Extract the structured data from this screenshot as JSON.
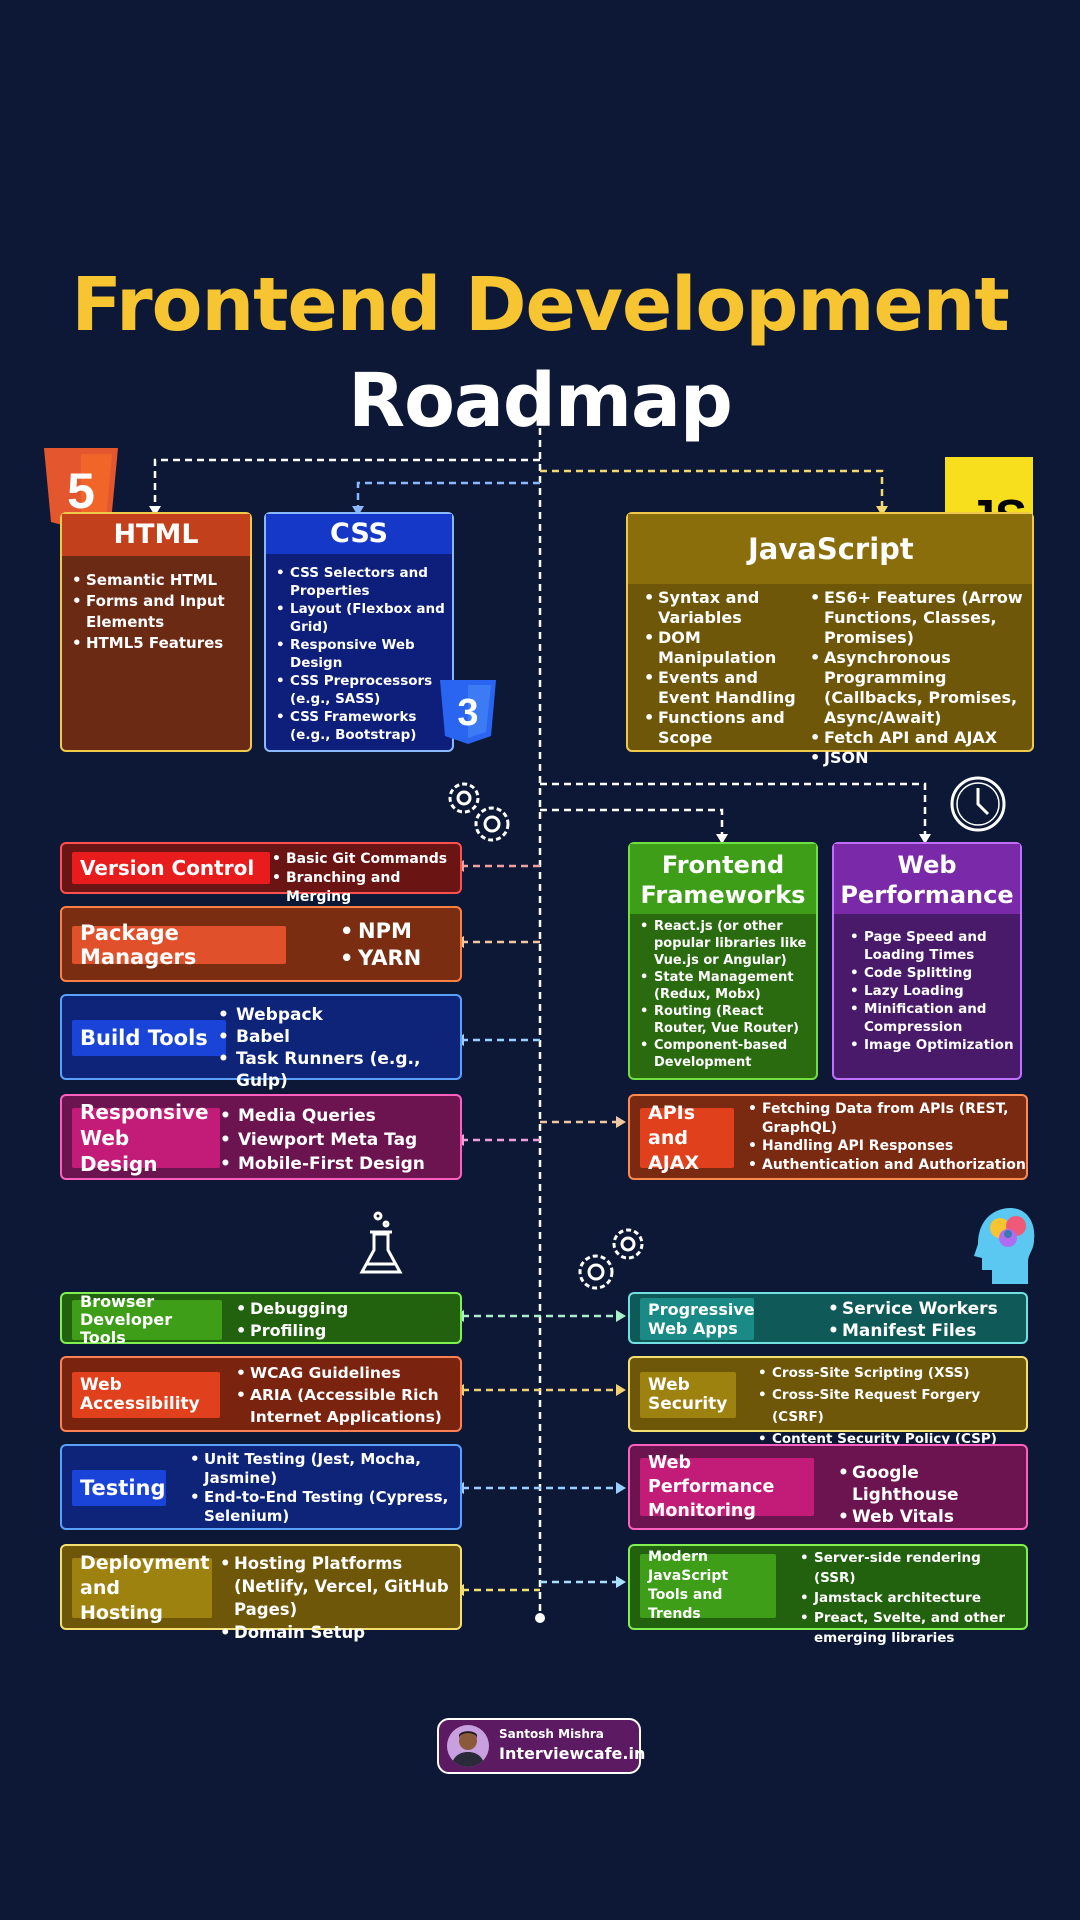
{
  "title": {
    "line1": "Frontend Development",
    "line2": "Roadmap"
  },
  "logos": {
    "html5": "5",
    "css3": "3",
    "js": "JS"
  },
  "html": {
    "title": "HTML",
    "items": [
      "Semantic HTML",
      "Forms and Input Elements",
      "HTML5 Features"
    ]
  },
  "css": {
    "title": "CSS",
    "items": [
      "CSS Selectors and Properties",
      "Layout (Flexbox and Grid)",
      "Responsive Web Design",
      "CSS Preprocessors (e.g., SASS)",
      "CSS Frameworks (e.g., Bootstrap)"
    ]
  },
  "javascript": {
    "title": "JavaScript",
    "col1": [
      "Syntax and Variables",
      "DOM Manipulation",
      "Events and Event Handling",
      "Functions and Scope"
    ],
    "col2": [
      "ES6+ Features (Arrow Functions, Classes, Promises)",
      "Asynchronous Programming (Callbacks, Promises, Async/Await)",
      "Fetch API and AJAX",
      "JSON"
    ]
  },
  "version_control": {
    "label": "Version Control",
    "items": [
      "Basic Git Commands",
      "Branching and Merging"
    ]
  },
  "package_managers": {
    "label": "Package Managers",
    "items": [
      "NPM",
      "YARN"
    ]
  },
  "build_tools": {
    "label": "Build Tools",
    "items": [
      "Webpack",
      "Babel",
      "Task Runners (e.g., Gulp)"
    ]
  },
  "responsive": {
    "label": "Responsive Web Design",
    "items": [
      "Media Queries",
      "Viewport Meta Tag",
      "Mobile-First Design"
    ]
  },
  "frameworks": {
    "title": "Frontend Frameworks",
    "items": [
      "React.js (or other popular libraries like Vue.js or Angular)",
      "State Management (Redux, Mobx)",
      "Routing (React Router, Vue Router)",
      "Component-based Development"
    ]
  },
  "web_performance": {
    "title": "Web Performance",
    "items": [
      "Page Speed and Loading Times",
      "Code Splitting",
      "Lazy Loading",
      "Minification and Compression",
      "Image Optimization"
    ]
  },
  "apis": {
    "label": "APIs and AJAX",
    "items": [
      "Fetching Data from APIs (REST, GraphQL)",
      "Handling API Responses",
      "Authentication and Authorization"
    ]
  },
  "devtools": {
    "label": "Browser Developer Tools",
    "items": [
      "Debugging",
      "Profiling"
    ]
  },
  "accessibility": {
    "label": "Web Accessibility",
    "items": [
      "WCAG Guidelines",
      "ARIA (Accessible Rich Internet Applications)"
    ]
  },
  "testing": {
    "label": "Testing",
    "items": [
      "Unit Testing (Jest, Mocha, Jasmine)",
      "End-to-End Testing (Cypress, Selenium)"
    ]
  },
  "deployment": {
    "label": "Deployment and Hosting",
    "items": [
      "Hosting Platforms (Netlify, Vercel, GitHub Pages)",
      "Domain Setup"
    ]
  },
  "pwa": {
    "label": "Progressive Web Apps",
    "items": [
      "Service Workers",
      "Manifest Files"
    ]
  },
  "security": {
    "label": "Web Security",
    "items": [
      "Cross-Site Scripting (XSS)",
      "Cross-Site Request Forgery (CSRF)",
      "Content Security Policy (CSP)"
    ]
  },
  "perf_monitoring": {
    "label": "Web Performance Monitoring",
    "items": [
      "Google Lighthouse",
      "Web Vitals"
    ]
  },
  "modern_js": {
    "label": "Modern JavaScript Tools and Trends",
    "items": [
      "Server-side rendering (SSR)",
      "Jamstack architecture",
      "Preact, Svelte, and other emerging libraries"
    ]
  },
  "footer": {
    "name": "Santosh Mishra",
    "site": "Interviewcafe.in"
  },
  "icons": [
    "gears-icon",
    "clock-icon",
    "flask-icon",
    "brain-head-icon",
    "avatar"
  ]
}
